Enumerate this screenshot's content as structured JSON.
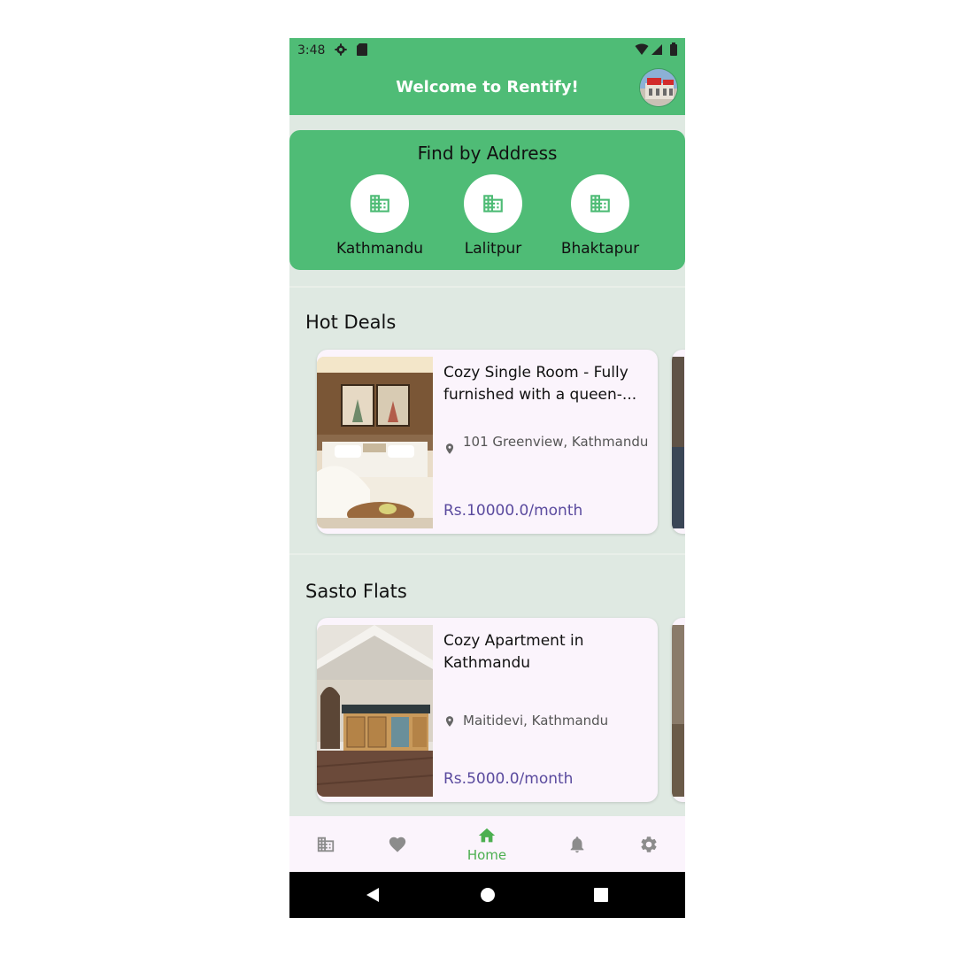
{
  "status_bar": {
    "time": "3:48"
  },
  "app_bar": {
    "title": "Welcome to Rentify!"
  },
  "find_by_address": {
    "title": "Find by Address",
    "cities": [
      {
        "name": "Kathmandu",
        "icon": "building-icon"
      },
      {
        "name": "Lalitpur",
        "icon": "building-icon"
      },
      {
        "name": "Bhaktapur",
        "icon": "building-icon"
      }
    ]
  },
  "sections": [
    {
      "title": "Hot Deals",
      "listing": {
        "title": "Cozy Single Room - Fully furnished with a queen-...",
        "location": "101 Greenview, Kathmandu",
        "price": "Rs.10000.0/month"
      }
    },
    {
      "title": "Sasto Flats",
      "listing": {
        "title": " Cozy Apartment in Kathmandu",
        "location": "Maitidevi, Kathmandu",
        "price": "Rs.5000.0/month"
      }
    }
  ],
  "bottom_nav": {
    "items": [
      {
        "icon": "building-icon",
        "label": ""
      },
      {
        "icon": "heart-icon",
        "label": ""
      },
      {
        "icon": "home-icon",
        "label": "Home",
        "active": true
      },
      {
        "icon": "bell-icon",
        "label": ""
      },
      {
        "icon": "gear-icon",
        "label": ""
      }
    ]
  },
  "colors": {
    "primary": "#4fbc76",
    "background": "#dfe9e2",
    "card": "#fbf4fc",
    "price": "#5a4a9e",
    "active_nav": "#4caf50"
  }
}
